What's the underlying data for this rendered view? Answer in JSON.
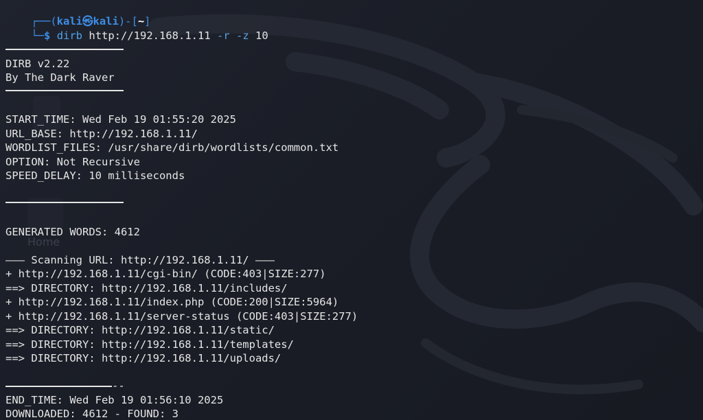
{
  "prompt": {
    "user": "kali",
    "skull": "㉿",
    "host": "kali",
    "dir": "~",
    "symbol": "$",
    "command": "dirb",
    "url": "http://192.168.1.11",
    "opt_r": "-r",
    "opt_z": "-z",
    "z_value": "10"
  },
  "banner": {
    "version": "DIRB v2.22",
    "author": "By The Dark Raver"
  },
  "info": [
    "START_TIME: Wed Feb 19 01:55:20 2025",
    "URL_BASE: http://192.168.1.11/",
    "WORDLIST_FILES: /usr/share/dirb/wordlists/common.txt",
    "OPTION: Not Recursive",
    "SPEED_DELAY: 10 milliseconds"
  ],
  "generated": "GENERATED WORDS: 4612",
  "scan_header": "——— Scanning URL: http://192.168.1.11/ ———",
  "results": [
    "+ http://192.168.1.11/cgi-bin/ (CODE:403|SIZE:277)",
    "==> DIRECTORY: http://192.168.1.11/includes/",
    "+ http://192.168.1.11/index.php (CODE:200|SIZE:5964)",
    "+ http://192.168.1.11/server-status (CODE:403|SIZE:277)",
    "==> DIRECTORY: http://192.168.1.11/static/",
    "==> DIRECTORY: http://192.168.1.11/templates/",
    "==> DIRECTORY: http://192.168.1.11/uploads/"
  ],
  "end_rule_suffix": "--",
  "end_time": "END_TIME: Wed Feb 19 01:56:10 2025",
  "downloaded": "DOWNLOADED: 4612 - FOUND: 3",
  "desktop_ghost_label": "Home",
  "colors": {
    "background": "#1b1e27",
    "prompt_blue": "#3d8ee8",
    "text": "#e6e6e6"
  }
}
